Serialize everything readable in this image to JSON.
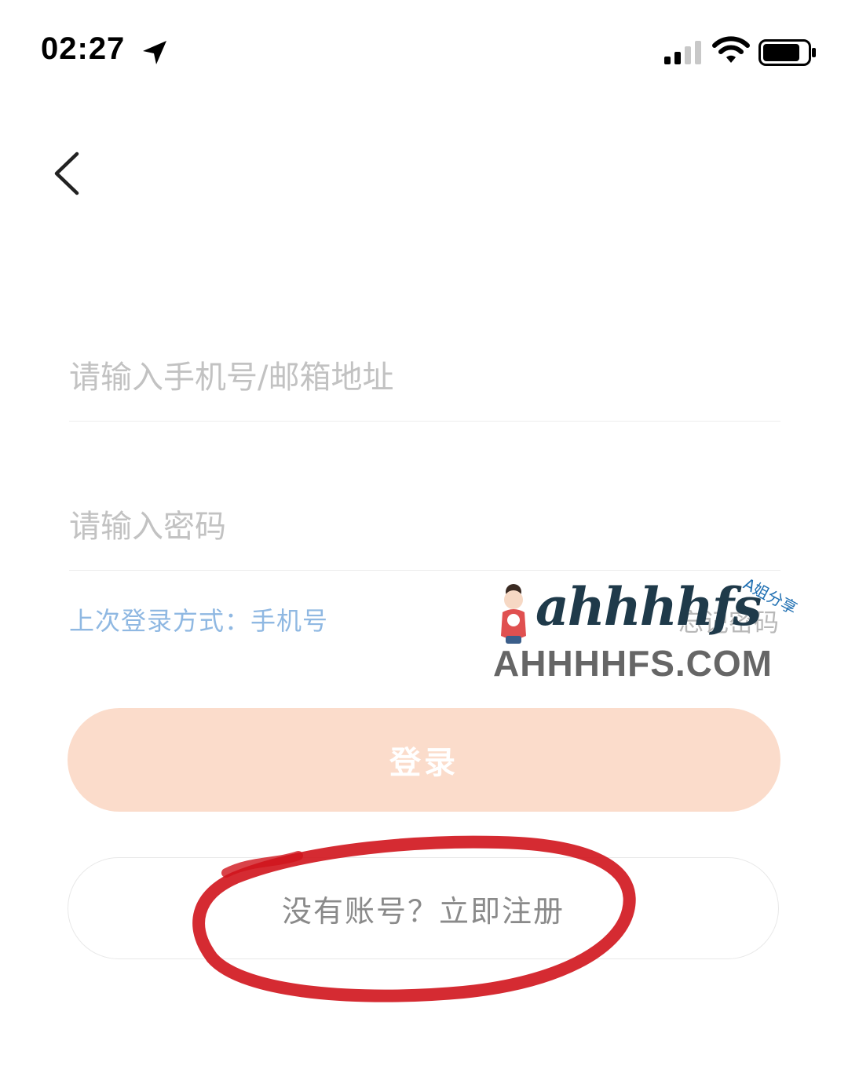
{
  "status_bar": {
    "time": "02:27",
    "icons": [
      "location-arrow-icon",
      "signal-bars-icon",
      "wifi-icon",
      "battery-icon"
    ]
  },
  "nav": {
    "back_icon": "chevron-left-icon"
  },
  "form": {
    "phone_placeholder": "请输入手机号/邮箱地址",
    "password_placeholder": "请输入密码",
    "last_login_text": "上次登录方式：手机号",
    "forgot_password": "忘记密码",
    "login_label": "登录",
    "register_label": "没有账号？立即注册"
  },
  "colors": {
    "login_button_bg": "#fbdccb",
    "last_login_text": "#8fb8e2",
    "annotation_circle": "#d0141c"
  },
  "watermark": {
    "script_text": "ahhhhfs",
    "share_text": "A姐分享",
    "domain_text": "AHHHHFS.COM"
  }
}
